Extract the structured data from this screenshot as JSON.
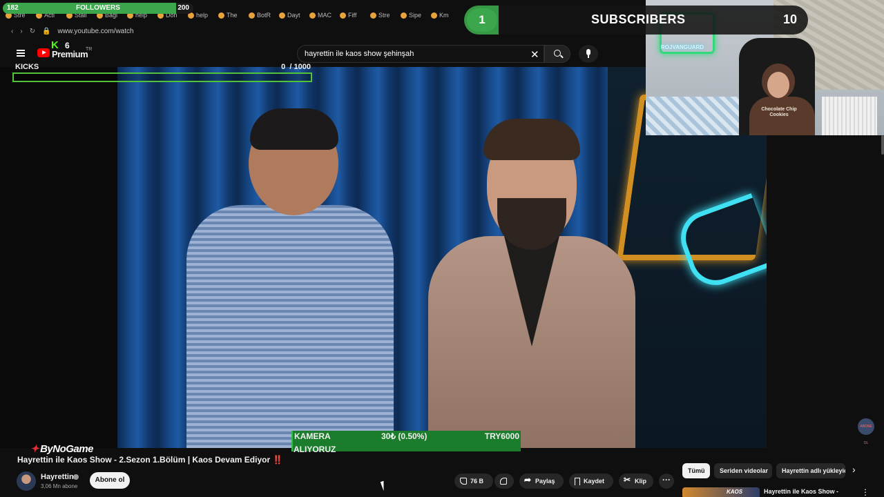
{
  "browser": {
    "url": "www.youtube.com/watch",
    "bookmarks": [
      "Stre",
      "Acti",
      "Stali",
      "Bağl",
      "help",
      "Don",
      "help",
      "The",
      "BotR",
      "Dayt",
      "MAC",
      "Fiff",
      "Stre",
      "Sipe",
      "Km"
    ]
  },
  "overlay": {
    "followers": {
      "label": "FOLLOWERS",
      "current": "182",
      "goal": "200",
      "progress": 0.91
    },
    "subscribers": {
      "label": "SUBSCRIBERS",
      "current": "1",
      "goal": "10",
      "progress": 0.1
    },
    "kicks": {
      "label": "KICKS",
      "current": "0",
      "separator": "/ 1000",
      "progress": 0.0,
      "brand_count": "6"
    },
    "donation": {
      "label_line1": "KAMERA",
      "label_line2": "ALIYORUZ",
      "amount": "30₺ (0.50%)",
      "goal": "TRY6000",
      "progress": 0.005
    },
    "webcam": {
      "neon_text": "ROJVANGUARD",
      "shirt_text": "Chocolate Chip Cookies"
    },
    "sponsor": "ByNoGame"
  },
  "youtube": {
    "logo_text": "Premium",
    "region": "TR",
    "search": {
      "query": "hayrettin ile kaos show şehinşah"
    },
    "video": {
      "title": "Hayrettin ile Kaos Show - 2.Sezon 1.Bölüm | Kaos Devam Ediyor ‼️",
      "channel": "Hayrettin",
      "subscribers": "3,06 Mn abone",
      "subscribe_label": "Abone ol",
      "likes": "76 B",
      "share_label": "Paylaş",
      "save_label": "Kaydet",
      "clip_label": "Klip",
      "more_label": "···",
      "watermark": "ABONE OL"
    },
    "chips": [
      "Tümü",
      "Seriden videolar",
      "Hayrettin adlı yükleyici"
    ],
    "recommendation": {
      "thumb_label": "KAOS",
      "title": "Hayrettin ile Kaos Show -"
    }
  },
  "colors": {
    "accent": "#3ba64b",
    "kick_green": "#53fc18",
    "yt_red": "#ff0000"
  }
}
